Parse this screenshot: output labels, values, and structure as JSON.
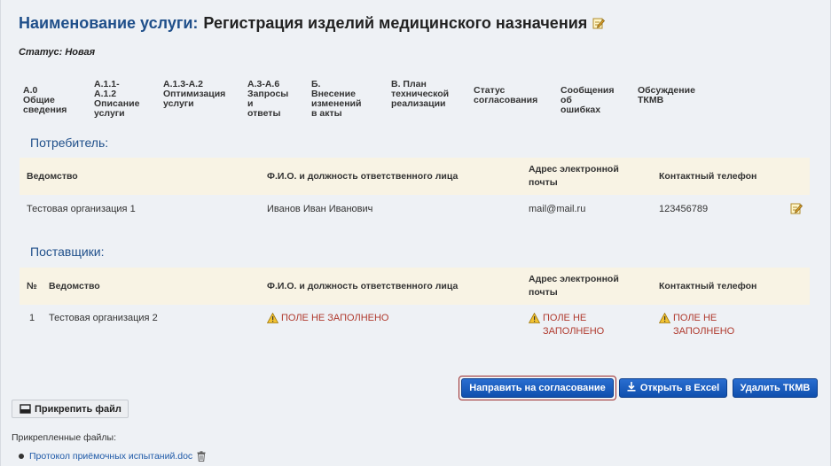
{
  "header": {
    "title_prefix": "Наименование услуги:",
    "title_value": "Регистрация изделий медицинского назначения",
    "status_label": "Статус:",
    "status_value": "Новая"
  },
  "tabs": [
    {
      "label": "А.0 Общие\nсведения"
    },
    {
      "label": "А.1.1-А.1.2\nОписание\nуслуги"
    },
    {
      "label": "А.1.3-А.2\nОптимизация\nуслуги"
    },
    {
      "label": "А.3-А.6\nЗапросы\nи ответы"
    },
    {
      "label": "Б. Внесение\nизменений\nв акты"
    },
    {
      "label": "В. План\nтехнической\nреализации"
    },
    {
      "label": "Статус\nсогласования"
    },
    {
      "label": "Сообщения\nоб ошибках"
    },
    {
      "label": "Обсуждение\nТКМВ"
    }
  ],
  "consumer": {
    "section_title": "Потребитель:",
    "columns": [
      "Ведомство",
      "Ф.И.О. и должность ответственного лица",
      "Адрес электронной\nпочты",
      "Контактный телефон"
    ],
    "rows": [
      {
        "org": "Тестовая организация 1",
        "person": "Иванов Иван Иванович",
        "email": "mail@mail.ru",
        "phone": "123456789"
      }
    ]
  },
  "suppliers": {
    "section_title": "Поставщики:",
    "columns": [
      "№",
      "Ведомство",
      "Ф.И.О. и должность ответственного лица",
      "Адрес электронной\nпочты",
      "Контактный телефон"
    ],
    "rows": [
      {
        "num": "1",
        "org": "Тестовая организация 2",
        "person": "ПОЛЕ НЕ ЗАПОЛНЕНО",
        "email": "ПОЛЕ НЕ\nЗАПОЛНЕНО",
        "phone": "ПОЛЕ НЕ\nЗАПОЛНЕНО"
      }
    ]
  },
  "actions": {
    "send_for_approval": "Направить на согласование",
    "open_in_excel": "Открыть в Excel",
    "delete_tkmv": "Удалить ТКМВ"
  },
  "attachments": {
    "attach_button": "Прикрепить файл",
    "attached_label": "Прикрепленные файлы:",
    "files": [
      {
        "name": "Протокол приёмочных испытаний.doc"
      }
    ]
  },
  "colors": {
    "accent": "#1f4f8a",
    "button": "#1a5fc2",
    "warning": "#b03a2e",
    "table_header": "#f8f3e4"
  }
}
